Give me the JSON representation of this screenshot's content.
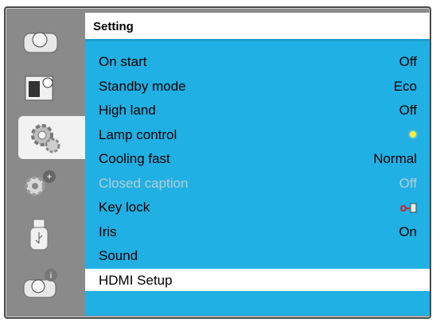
{
  "panel": {
    "title": "Setting"
  },
  "sidebar": {
    "items": [
      {
        "icon": "projector-icon"
      },
      {
        "icon": "image-adjust-icon"
      },
      {
        "icon": "gear-icon",
        "active": true
      },
      {
        "icon": "extended-settings-icon"
      },
      {
        "icon": "usb-icon"
      },
      {
        "icon": "info-icon"
      }
    ]
  },
  "rows": [
    {
      "label": "On start",
      "value": "Off"
    },
    {
      "label": "Standby mode",
      "value": "Eco"
    },
    {
      "label": "High land",
      "value": "Off"
    },
    {
      "label": "Lamp control",
      "value_icon": "lamp-icon"
    },
    {
      "label": "Cooling fast",
      "value": "Normal"
    },
    {
      "label": "Closed caption",
      "value": "Off",
      "disabled": true
    },
    {
      "label": "Key lock",
      "value_icon": "key-lock-icon"
    },
    {
      "label": "Iris",
      "value": "On"
    },
    {
      "label": "Sound",
      "value": ""
    },
    {
      "label": "HDMI Setup",
      "value": "",
      "selected": true
    }
  ],
  "colors": {
    "panel_bg": "#20b0e3",
    "selected_row": "#ffffff",
    "disabled_text": "#b7cfd8",
    "accent": "#1e9fd0"
  }
}
